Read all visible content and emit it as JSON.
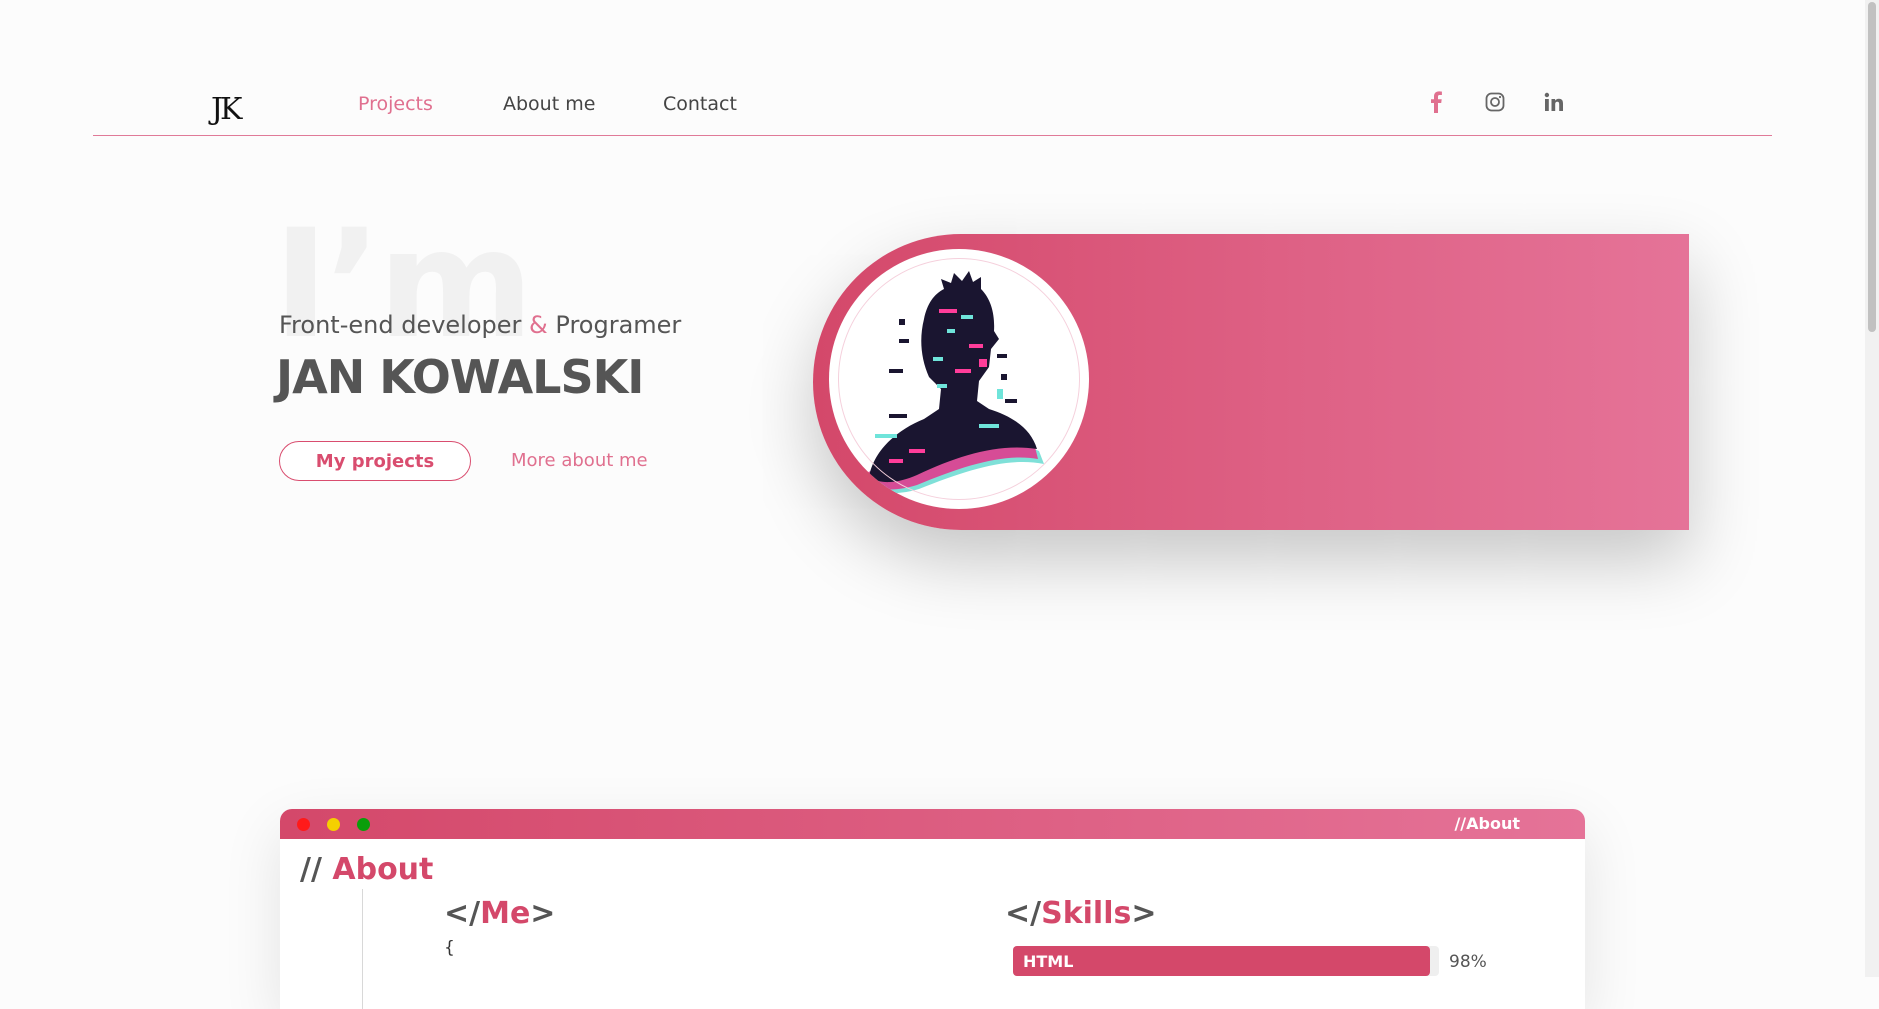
{
  "nav": {
    "logo": "JK",
    "links": [
      "Projects",
      "About me",
      "Contact"
    ],
    "social": [
      "facebook-icon",
      "instagram-icon",
      "linkedin-icon"
    ]
  },
  "hero": {
    "bg_word": "I’m",
    "subtitle_part1": "Front-end developer",
    "subtitle_amp": "&",
    "subtitle_part2": "Programer",
    "name": "JAN KOWALSKI",
    "primary_button": "My projects",
    "secondary_button": "More about me"
  },
  "about_window": {
    "titlebar_label": "//About",
    "dots": [
      "#ff1a1a",
      "#f5d000",
      "#0a9e0a"
    ],
    "heading_prefix": "//",
    "heading": "About",
    "me_open": "</",
    "me_word": "Me",
    "me_close": ">",
    "brace": "{",
    "skills_open": "</",
    "skills_word": "Skills",
    "skills_close": ">",
    "skills": [
      {
        "name": "HTML",
        "percent_label": "98%",
        "value": 98
      }
    ]
  },
  "colors": {
    "accent": "#d94d6f",
    "accent_light": "#e0708f",
    "text": "#555555"
  }
}
